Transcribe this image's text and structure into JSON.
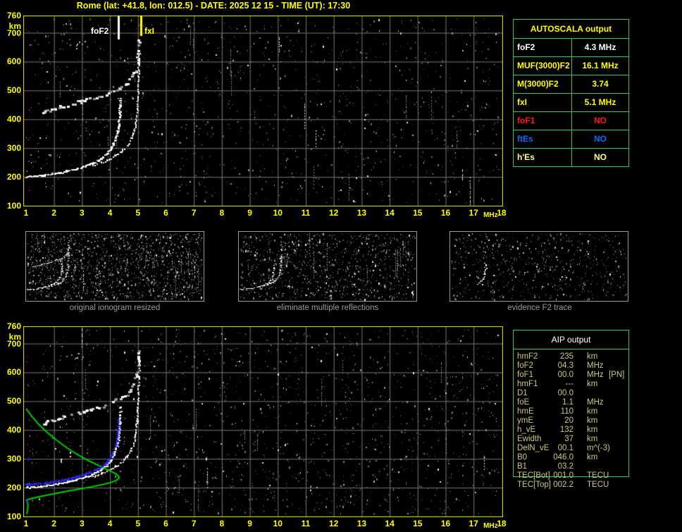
{
  "title": "Rome (lat: +41.8, lon: 012.5) - DATE: 2025 12 15 - TIME (UT): 17:30",
  "colors": {
    "background": "#000000",
    "title_yellow": "#ffff00",
    "axis_labels": "#ffff00",
    "plot_border": "#e8e800",
    "grid": "#777777",
    "trace_white": "#ffffff",
    "second_hop_gray": "#c8c8c8",
    "profile_green": "#00cc00",
    "restored_blue": "#2d2dff",
    "panel_border": "#9a9a9a",
    "caption_gray": "#9a9a9a",
    "table_border_green": "#2fc55f",
    "aip_text": "#c9c97a",
    "value_white": "#ffffff",
    "value_yellow": "#ffff00",
    "value_pale_yellow": "#ffff80",
    "value_red": "#ff1515",
    "value_blue": "#0a6bff"
  },
  "autoscala_table": {
    "title": "AUTOSCALA output",
    "rows": [
      {
        "label": "foF2",
        "value": "4.3 MHz",
        "color": "#ffffff"
      },
      {
        "label": "MUF(3000)F2",
        "value": "16.1 MHz",
        "color": "#ffff00"
      },
      {
        "label": "M(3000)F2",
        "value": "3.74",
        "color": "#ffff00"
      },
      {
        "label": "fxI",
        "value": "5.1 MHz",
        "color": "#ffff00"
      },
      {
        "label": "foF1",
        "value": "NO",
        "color": "#ff1515"
      },
      {
        "label": "ftEs",
        "value": "NO",
        "color": "#0a6bff"
      },
      {
        "label": "h'Es",
        "value": "NO",
        "color": "#ffff80"
      }
    ]
  },
  "aip_table": {
    "title": "AIP output",
    "rows": [
      {
        "param": "hmF2",
        "value": "235",
        "unit": "km",
        "extra": ""
      },
      {
        "param": "foF2",
        "value": "04.3",
        "unit": "MHz",
        "extra": ""
      },
      {
        "param": "foF1",
        "value": "00.0",
        "unit": "MHz",
        "extra": "[PN]"
      },
      {
        "param": "hmF1",
        "value": "---",
        "unit": "km",
        "extra": ""
      },
      {
        "param": "D1",
        "value": "00.0",
        "unit": "",
        "extra": ""
      },
      {
        "param": "foE",
        "value": "1.1",
        "unit": "MHz",
        "extra": ""
      },
      {
        "param": "hmE",
        "value": "110",
        "unit": "km",
        "extra": ""
      },
      {
        "param": "ymE",
        "value": "20",
        "unit": "km",
        "extra": ""
      },
      {
        "param": "h_vE",
        "value": "132",
        "unit": "km",
        "extra": ""
      },
      {
        "param": "Ewidth",
        "value": "37",
        "unit": "km",
        "extra": ""
      },
      {
        "param": "DelN_vE",
        "value": "00.1",
        "unit": "m^(-3)",
        "extra": ""
      },
      {
        "param": "B0",
        "value": "046.0",
        "unit": "km",
        "extra": ""
      },
      {
        "param": "B1",
        "value": "03.2",
        "unit": "",
        "extra": ""
      },
      {
        "param": "TEC[Bot]",
        "value": "001.0",
        "unit": "TECU",
        "extra": ""
      },
      {
        "param": "TEC[Top]",
        "value": "002.2",
        "unit": "TECU",
        "extra": ""
      }
    ]
  },
  "panels": [
    {
      "caption": "original ionogram resized",
      "traces": [
        "F2_ordinary",
        "F2_extraordinary",
        "second_hop"
      ],
      "noise": 1600
    },
    {
      "caption": "eliminate multiple reflections",
      "traces": [
        "F2_ordinary",
        "F2_extraordinary"
      ],
      "noise": 1050
    },
    {
      "caption": "evidence F2 trace",
      "traces": [
        "F2_cusp"
      ],
      "noise": 650
    }
  ],
  "traces": {
    "F2_ordinary": [
      [
        1.0,
        201
      ],
      [
        1.3,
        203
      ],
      [
        1.6,
        206
      ],
      [
        1.9,
        210
      ],
      [
        2.2,
        215
      ],
      [
        2.5,
        221
      ],
      [
        2.8,
        228
      ],
      [
        3.1,
        237
      ],
      [
        3.4,
        249
      ],
      [
        3.65,
        262
      ],
      [
        3.85,
        278
      ],
      [
        4.0,
        295
      ],
      [
        4.12,
        315
      ],
      [
        4.22,
        340
      ],
      [
        4.29,
        372
      ],
      [
        4.33,
        410
      ],
      [
        4.35,
        450
      ],
      [
        4.36,
        480
      ]
    ],
    "F2_extraordinary": [
      [
        3.4,
        240
      ],
      [
        3.7,
        250
      ],
      [
        3.95,
        261
      ],
      [
        4.2,
        274
      ],
      [
        4.4,
        289
      ],
      [
        4.6,
        308
      ],
      [
        4.75,
        330
      ],
      [
        4.85,
        356
      ],
      [
        4.92,
        390
      ],
      [
        4.96,
        430
      ],
      [
        4.99,
        480
      ],
      [
        5.01,
        530
      ],
      [
        5.03,
        590
      ],
      [
        5.04,
        640
      ]
    ],
    "second_hop": [
      [
        1.6,
        424
      ],
      [
        1.9,
        434
      ],
      [
        2.2,
        443
      ],
      [
        2.5,
        452
      ],
      [
        2.9,
        462
      ],
      [
        3.3,
        472
      ],
      [
        3.7,
        483
      ],
      [
        4.0,
        494
      ],
      [
        4.3,
        507
      ],
      [
        4.55,
        522
      ],
      [
        4.75,
        541
      ],
      [
        4.88,
        565
      ],
      [
        4.96,
        598
      ],
      [
        5.0,
        640
      ],
      [
        5.02,
        680
      ]
    ],
    "third_hop_specks": [
      [
        2.45,
        655
      ],
      [
        2.6,
        662
      ],
      [
        2.75,
        650
      ],
      [
        2.9,
        668
      ],
      [
        3.0,
        658
      ],
      [
        3.1,
        665
      ]
    ],
    "F2_cusp": [
      [
        3.6,
        258
      ],
      [
        3.8,
        272
      ],
      [
        3.95,
        288
      ],
      [
        4.08,
        308
      ],
      [
        4.18,
        332
      ],
      [
        4.26,
        362
      ],
      [
        4.31,
        398
      ],
      [
        4.33,
        435
      ],
      [
        4.3,
        462
      ]
    ],
    "profile_green": [
      [
        1.0,
        474
      ],
      [
        1.2,
        448
      ],
      [
        1.45,
        420
      ],
      [
        1.75,
        392
      ],
      [
        2.1,
        364
      ],
      [
        2.45,
        339
      ],
      [
        2.8,
        317
      ],
      [
        3.15,
        298
      ],
      [
        3.5,
        281
      ],
      [
        3.8,
        267
      ],
      [
        4.05,
        256
      ],
      [
        4.2,
        248
      ],
      [
        4.3,
        241
      ],
      [
        4.33,
        236
      ],
      [
        4.3,
        230
      ],
      [
        4.2,
        224
      ],
      [
        4.0,
        217
      ],
      [
        3.7,
        210
      ],
      [
        3.35,
        203
      ],
      [
        2.95,
        196
      ],
      [
        2.55,
        189
      ],
      [
        2.15,
        182
      ],
      [
        1.75,
        174
      ],
      [
        1.4,
        167
      ],
      [
        1.15,
        161
      ],
      [
        1.0,
        157
      ]
    ],
    "profile_E": [
      [
        1.03,
        152
      ],
      [
        1.06,
        144
      ],
      [
        1.07,
        135
      ],
      [
        1.06,
        126
      ],
      [
        1.04,
        117
      ],
      [
        1.03,
        108
      ]
    ],
    "restored_blue": [
      [
        1.0,
        210
      ],
      [
        1.3,
        212
      ],
      [
        1.6,
        214
      ],
      [
        1.9,
        218
      ],
      [
        2.2,
        223
      ],
      [
        2.5,
        229
      ],
      [
        2.8,
        236
      ],
      [
        3.1,
        245
      ],
      [
        3.4,
        256
      ],
      [
        3.65,
        268
      ],
      [
        3.85,
        283
      ],
      [
        4.0,
        300
      ],
      [
        4.12,
        320
      ],
      [
        4.22,
        345
      ],
      [
        4.28,
        378
      ],
      [
        4.31,
        415
      ],
      [
        4.33,
        445
      ]
    ],
    "blue_strays": [
      [
        1.1,
        298
      ],
      [
        1.05,
        152
      ],
      [
        1.08,
        208
      ]
    ]
  },
  "chart_data": [
    {
      "id": "autoscaled_ionogram",
      "type": "scatter",
      "xlabel": "MHz",
      "ylabel": "km",
      "xlim": [
        1,
        18
      ],
      "ylim": [
        100,
        760
      ],
      "xticks": [
        1,
        2,
        3,
        4,
        5,
        6,
        7,
        8,
        9,
        10,
        11,
        12,
        13,
        14,
        15,
        16,
        17,
        18
      ],
      "yticks": [
        760,
        700,
        600,
        500,
        400,
        300,
        200,
        100
      ],
      "grid": true,
      "series": [
        "F2_ordinary",
        "F2_extraordinary",
        "second_hop",
        "third_hop_specks"
      ],
      "annotations": [
        {
          "label": "foF2",
          "freq_mhz": 4.3,
          "color": "#ffffff"
        },
        {
          "label": "fxI",
          "freq_mhz": 5.1,
          "color": "#ffff00"
        }
      ]
    },
    {
      "id": "aip_profile_ionogram",
      "type": "scatter",
      "xlabel": "MHz",
      "ylabel": "km",
      "xlim": [
        1,
        18
      ],
      "ylim": [
        100,
        760
      ],
      "xticks": [
        1,
        2,
        3,
        4,
        5,
        6,
        7,
        8,
        9,
        10,
        11,
        12,
        13,
        14,
        15,
        16,
        17,
        18
      ],
      "yticks": [
        760,
        700,
        600,
        500,
        400,
        300,
        200,
        100
      ],
      "grid": true,
      "series": [
        "F2_ordinary",
        "F2_extraordinary",
        "second_hop",
        "third_hop_specks"
      ],
      "overlays": [
        {
          "name": "electron_density_profile",
          "trace": "profile_green",
          "color": "#00cc00"
        },
        {
          "name": "E_region_profile",
          "trace": "profile_E",
          "color": "#00cc00"
        },
        {
          "name": "restored_trace_markers",
          "trace": "restored_blue",
          "color": "#2d2dff"
        },
        {
          "name": "stray_markers",
          "trace": "blue_strays",
          "color": "#2d2dff"
        }
      ]
    }
  ]
}
